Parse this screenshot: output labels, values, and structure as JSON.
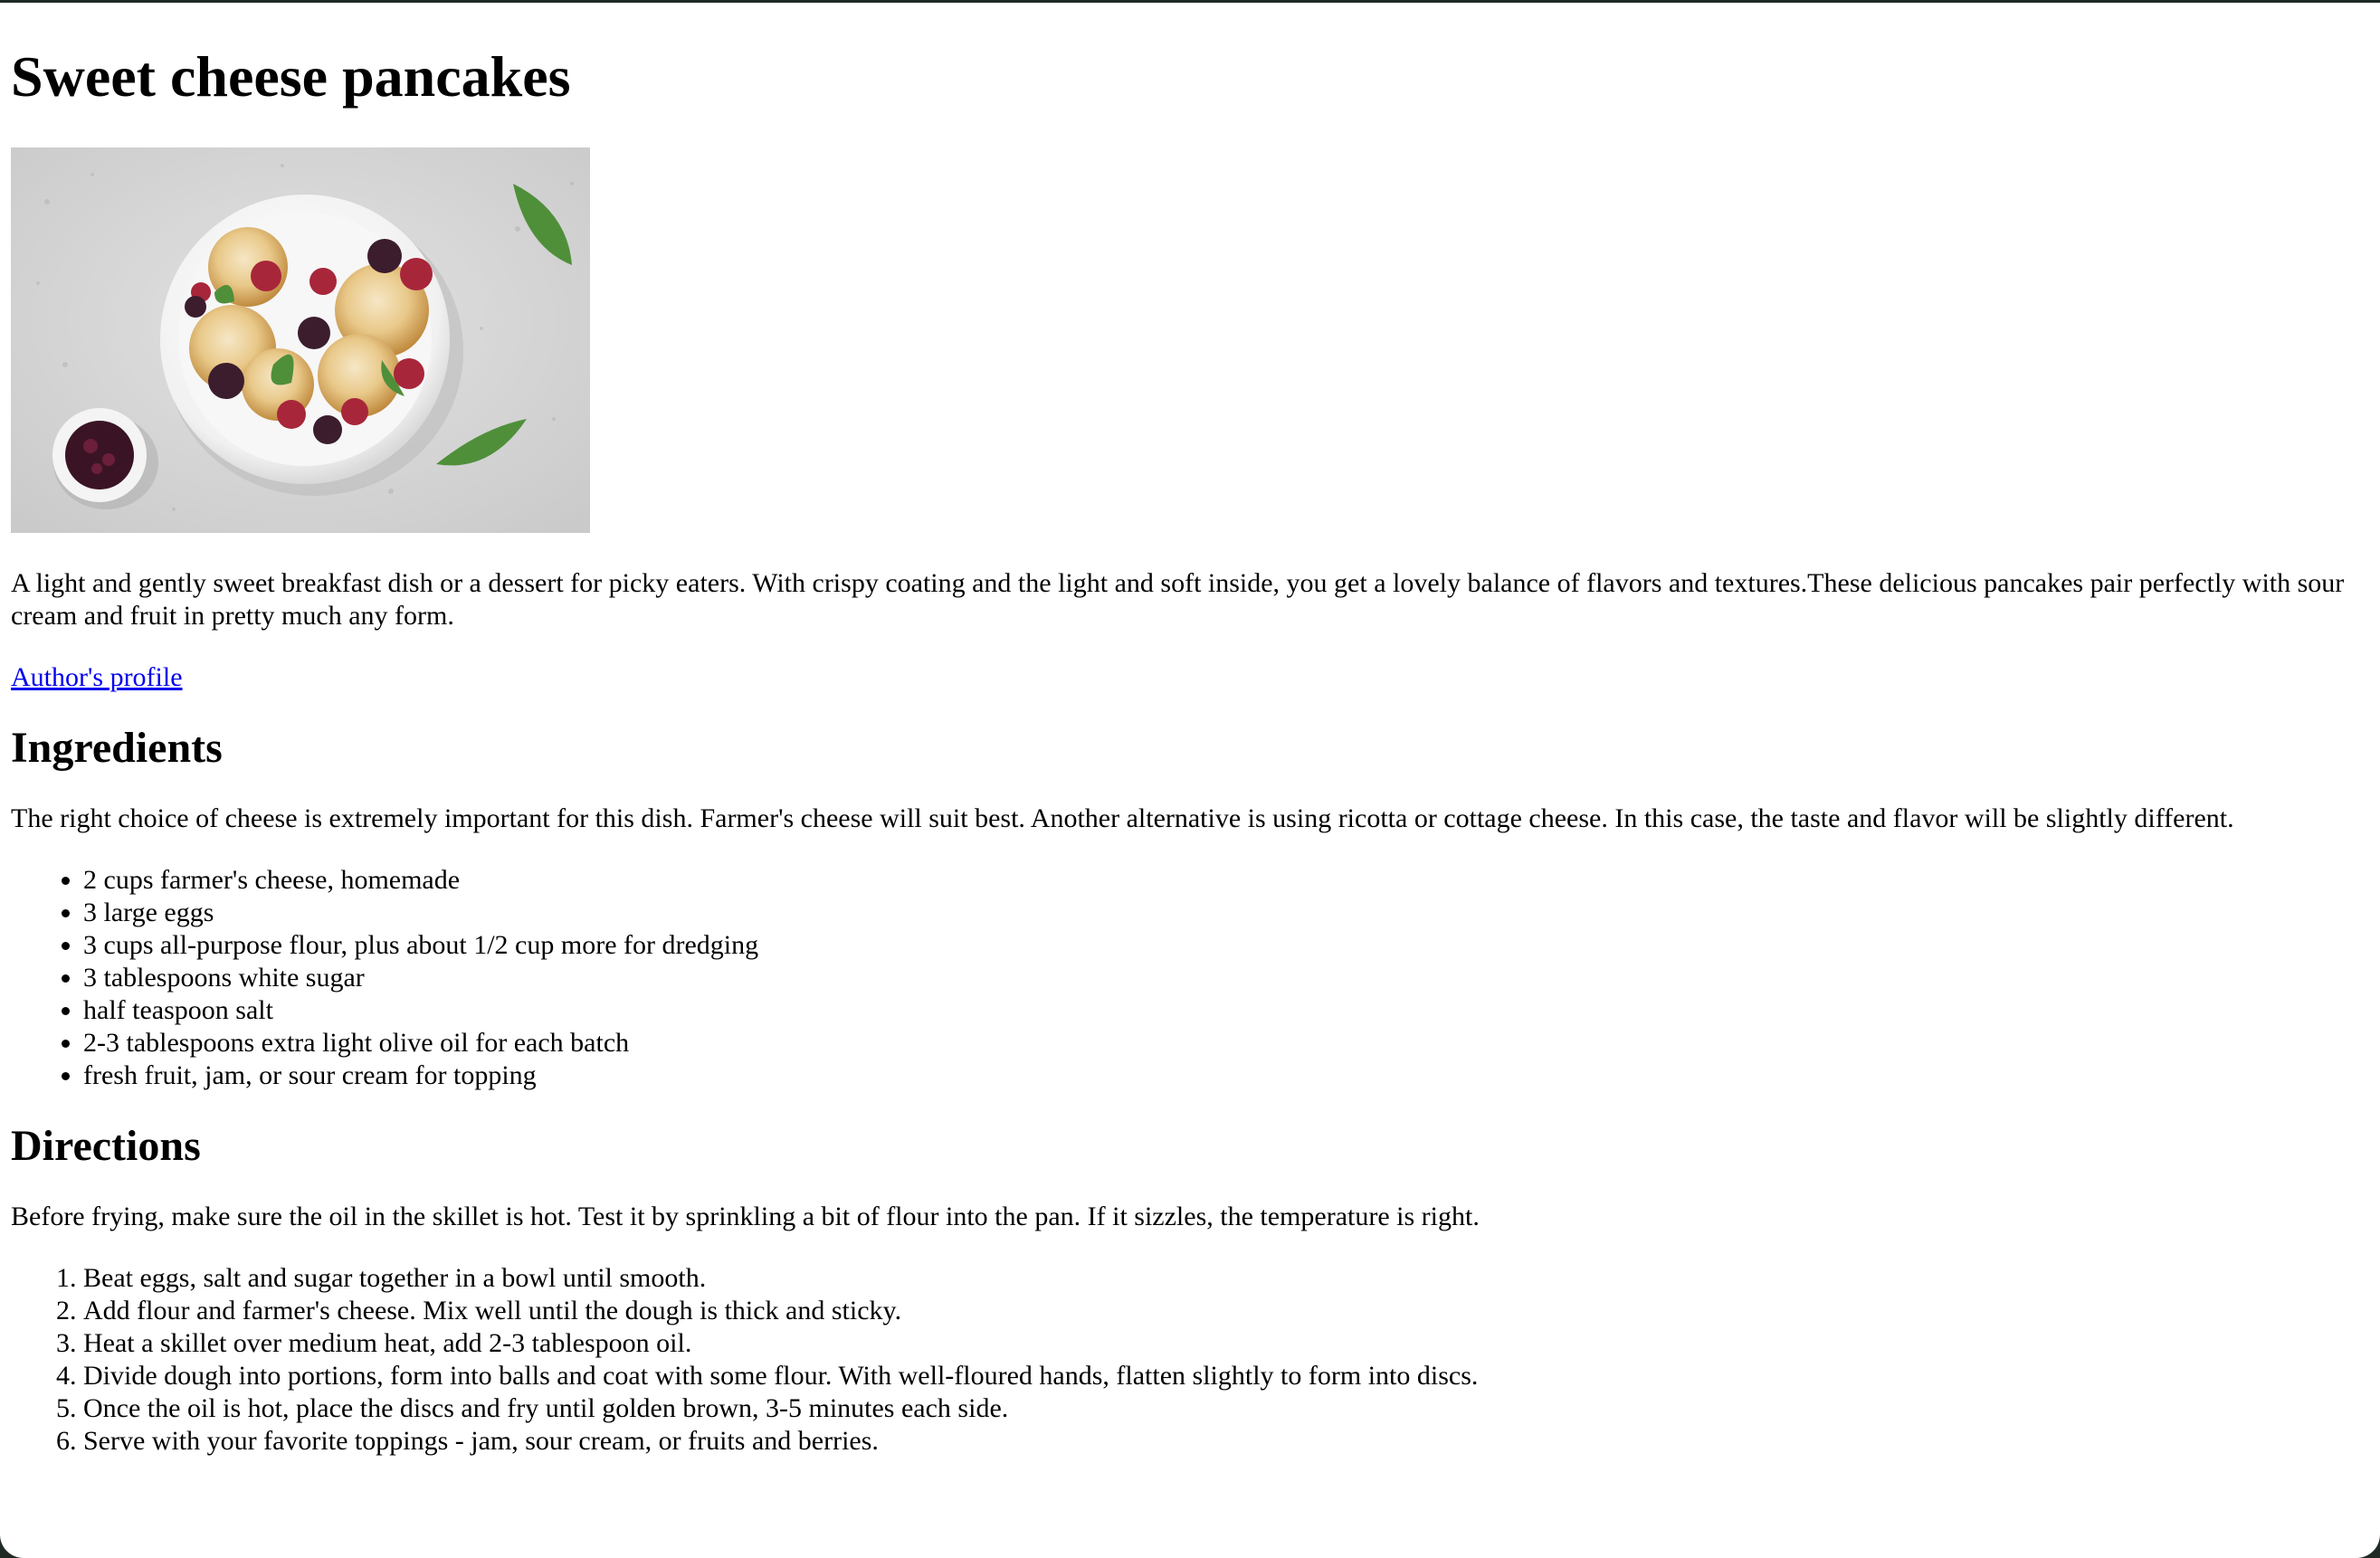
{
  "page": {
    "title": "Sweet cheese pancakes",
    "image": {
      "alt": "Sweet cheese pancakes with berries"
    },
    "description": "A light and gently sweet breakfast dish or a dessert for picky eaters. With crispy coating and the light and soft inside, you get a lovely balance of flavors and textures.These delicious pancakes pair perfectly with sour cream and fruit in pretty much any form.",
    "author_link": "Author's profile"
  },
  "ingredients": {
    "heading": "Ingredients",
    "intro": "The right choice of cheese is extremely important for this dish. Farmer's cheese will suit best. Another alternative is using ricotta or cottage cheese. In this case, the taste and flavor will be slightly different.",
    "items": [
      "2 cups farmer's cheese, homemade",
      "3 large eggs",
      "3 cups all-purpose flour, plus about 1/2 cup more for dredging",
      "3 tablespoons white sugar",
      "half teaspoon salt",
      "2-3 tablespoons extra light olive oil for each batch",
      "fresh fruit, jam, or sour cream for topping"
    ]
  },
  "directions": {
    "heading": "Directions",
    "intro": "Before frying, make sure the oil in the skillet is hot. Test it by sprinkling a bit of flour into the pan. If it sizzles, the temperature is right.",
    "steps": [
      "Beat eggs, salt and sugar together in a bowl until smooth.",
      "Add flour and farmer's cheese. Mix well until the dough is thick and sticky.",
      "Heat a skillet over medium heat, add 2-3 tablespoon oil.",
      "Divide dough into portions, form into balls and coat with some flour. With well-floured hands, flatten slightly to form into discs.",
      "Once the oil is hot, place the discs and fry until golden brown, 3-5 minutes each side.",
      "Serve with your favorite toppings - jam, sour cream, or fruits and berries."
    ]
  },
  "colors": {
    "link": "#0000ee",
    "background": "#ffffff",
    "frame": "#1f2a24"
  }
}
